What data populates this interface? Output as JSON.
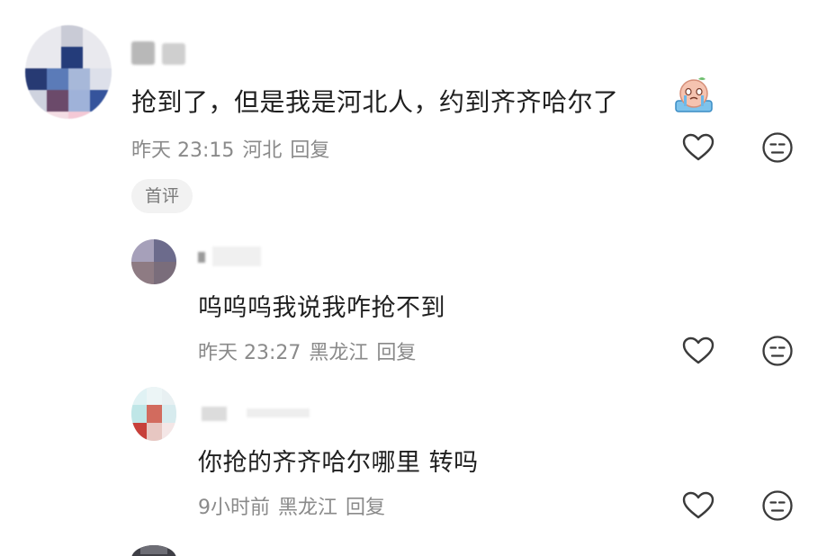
{
  "comments": [
    {
      "text": "抢到了，但是我是河北人，约到齐齐哈尔了",
      "time": "昨天 23:15",
      "location": "河北",
      "reply_label": "回复",
      "badge": "首评"
    }
  ],
  "replies": [
    {
      "text": "呜呜呜我说我咋抢不到",
      "time": "昨天 23:27",
      "location": "黑龙江",
      "reply_label": "回复"
    },
    {
      "text": "你抢的齐齐哈尔哪里 转吗",
      "time": "9小时前",
      "location": "黑龙江",
      "reply_label": "回复"
    }
  ],
  "colors": {
    "text": "#1f1f1f",
    "meta": "#8a8a8a",
    "badge_bg": "#f2f2f2",
    "icon": "#3a3a3a"
  },
  "icons": [
    "heart-icon",
    "dislike-face-icon",
    "crying-sticker-icon"
  ]
}
